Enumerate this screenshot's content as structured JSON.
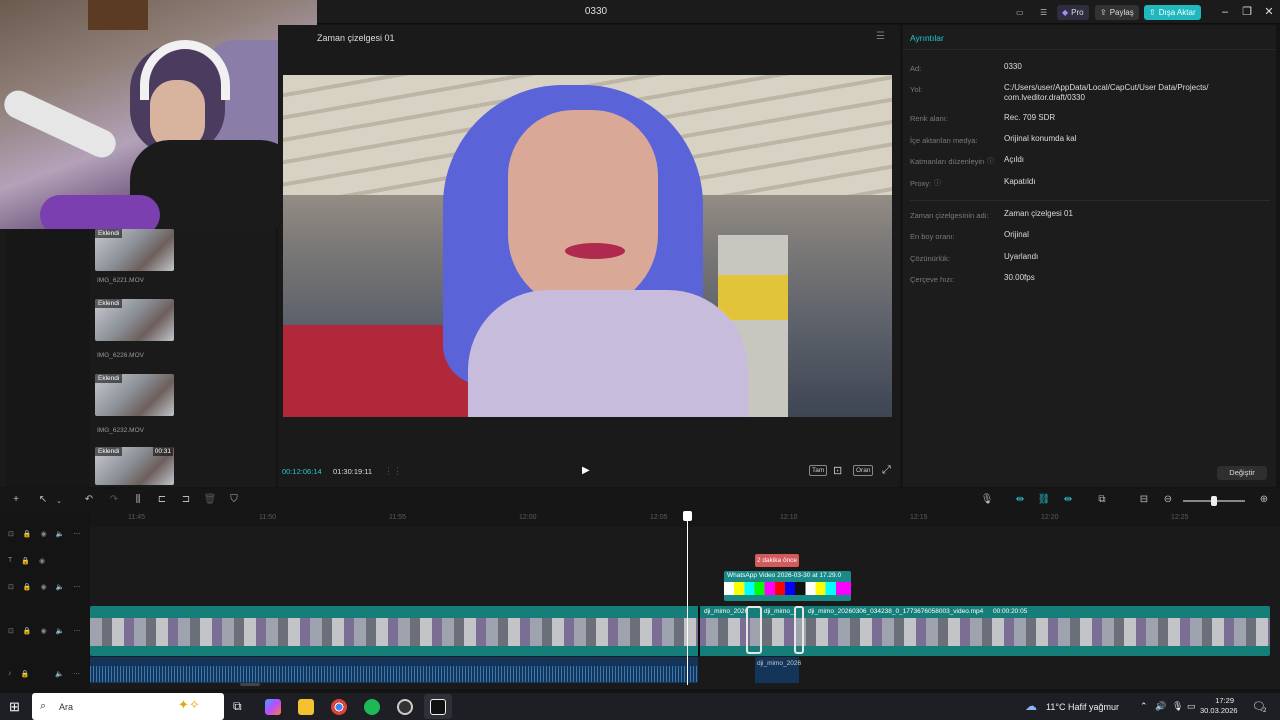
{
  "window": {
    "title": "0330",
    "pro_label": "Pro",
    "share_label": "Paylaş",
    "export_label": "Dışa Aktar"
  },
  "media": {
    "items": [
      {
        "badge": "Eklendi",
        "name": "IMG_6221.MOV"
      },
      {
        "badge": "Eklendi",
        "name": "IMG_6226.MOV"
      },
      {
        "badge": "Eklendi",
        "name": "IMG_6232.MOV"
      },
      {
        "badge": "Eklendi",
        "duration": "00:31"
      }
    ]
  },
  "player": {
    "title": "Zaman çizelgesi 01",
    "timecode_current": "00:12:06:14",
    "timecode_total": "01:30:19:11",
    "full_label": "Tam",
    "ratio_label": "Oran"
  },
  "details": {
    "tab": "Ayrıntılar",
    "rows": [
      {
        "key": "Ad:",
        "value": "0330"
      },
      {
        "key": "Yol:",
        "value": "C:/Users/user/AppData/Local/CapCut/User Data/Projects/ com.lveditor.draft/0330"
      },
      {
        "key": "Renk alanı:",
        "value": "Rec. 709 SDR"
      },
      {
        "key": "İçe aktarılan medya:",
        "value": "Orijinal konumda kal"
      },
      {
        "key": "Katmanları düzenleyin",
        "value": "Açıldı"
      },
      {
        "key": "Proxy:",
        "value": "Kapatıldı"
      },
      {
        "key": "Zaman çizelgesinin adı:",
        "value": "Zaman çizelgesi 01"
      },
      {
        "key": "En boy oranı:",
        "value": "Orijinal"
      },
      {
        "key": "Çözünürlük:",
        "value": "Uyarlandı"
      },
      {
        "key": "Çerçeve hızı:",
        "value": "30.00fps"
      }
    ],
    "change_label": "Değiştir"
  },
  "ruler": {
    "ticks": [
      "11:45",
      "11:50",
      "11:55",
      "12:00",
      "12:05",
      "12:10",
      "12:15",
      "12:20",
      "12:25"
    ]
  },
  "timeline": {
    "note": "2 dakika önce",
    "overlay_clip": "WhatsApp Video 2026-03-30 at 17.29.0",
    "clip_a": "dji_mimo_2026",
    "clip_b": "dji_mimo_",
    "clip_c": "dji_mimo_20260306_034238_0_1773676058003_video.mp4",
    "clip_c_duration": "00:00:20:05",
    "audio_clip": "dji_mimo_2026"
  },
  "taskbar": {
    "search_placeholder": "Ara",
    "weather": "11°C  Hafif yağmur",
    "time": "17:29",
    "date": "30.03.2026",
    "notif_count": "2"
  }
}
